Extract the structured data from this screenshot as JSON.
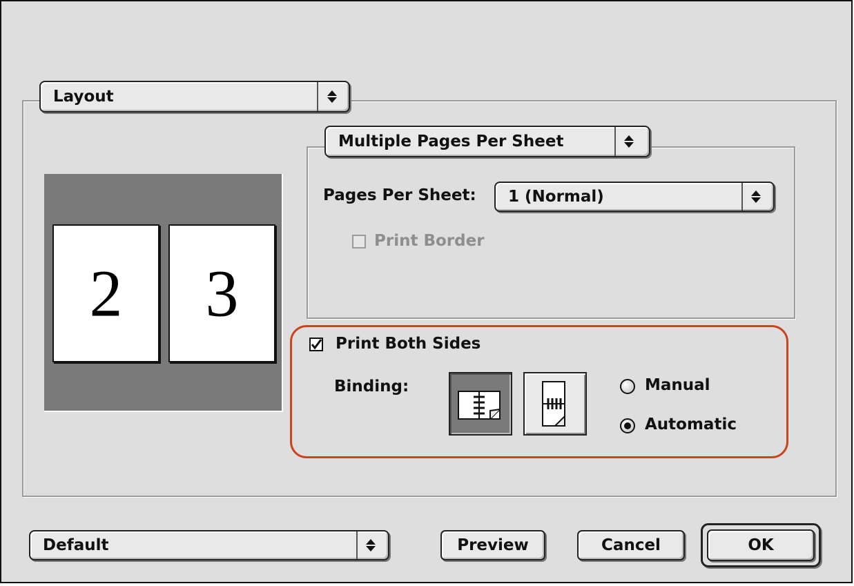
{
  "dialog": {
    "panel_menu": {
      "selected": "Layout"
    },
    "section_menu": {
      "selected": "Multiple Pages Per Sheet"
    },
    "pages_per_sheet": {
      "label": "Pages Per Sheet:",
      "selected": "1 (Normal)"
    },
    "print_border": {
      "label": "Print Border",
      "checked": false,
      "enabled": false
    },
    "preview_pages": [
      "2",
      "3"
    ],
    "print_both_sides": {
      "label": "Print Both Sides",
      "checked": true
    },
    "binding": {
      "label": "Binding:",
      "options": [
        {
          "icon": "book-binding-left-icon",
          "selected": true
        },
        {
          "icon": "tablet-binding-top-icon",
          "selected": false
        }
      ]
    },
    "duplex_mode": {
      "options": [
        {
          "label": "Manual",
          "selected": false
        },
        {
          "label": "Automatic",
          "selected": true
        }
      ]
    },
    "settings_menu": {
      "selected": "Default"
    },
    "buttons": {
      "preview": "Preview",
      "cancel": "Cancel",
      "ok": "OK"
    }
  },
  "colors": {
    "highlight": "#c8451f",
    "dialog_bg": "#dedede",
    "preview_bg": "#7a7a7a"
  }
}
